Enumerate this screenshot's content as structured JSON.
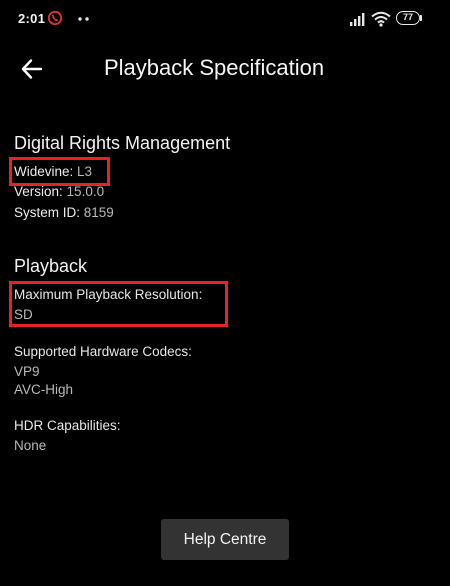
{
  "status_bar": {
    "time": "2:01",
    "battery": "77"
  },
  "app_bar": {
    "title": "Playback Specification"
  },
  "drm": {
    "title": "Digital Rights Management",
    "widevine_label": "Widevine:",
    "widevine_value": "L3",
    "version_label": "Version:",
    "version_value": "15.0.0",
    "system_id_label": "System ID:",
    "system_id_value": "8159"
  },
  "playback": {
    "title": "Playback",
    "max_resolution_label": "Maximum Playback Resolution:",
    "max_resolution_value": "SD",
    "codecs_label": "Supported Hardware Codecs:",
    "codecs": [
      "VP9",
      "AVC-High"
    ],
    "hdr_label": "HDR Capabilities:",
    "hdr_value": "None"
  },
  "help_button": {
    "label": "Help Centre"
  },
  "colors": {
    "background": "#000000",
    "highlight": "#e3242b",
    "button": "#333333"
  }
}
